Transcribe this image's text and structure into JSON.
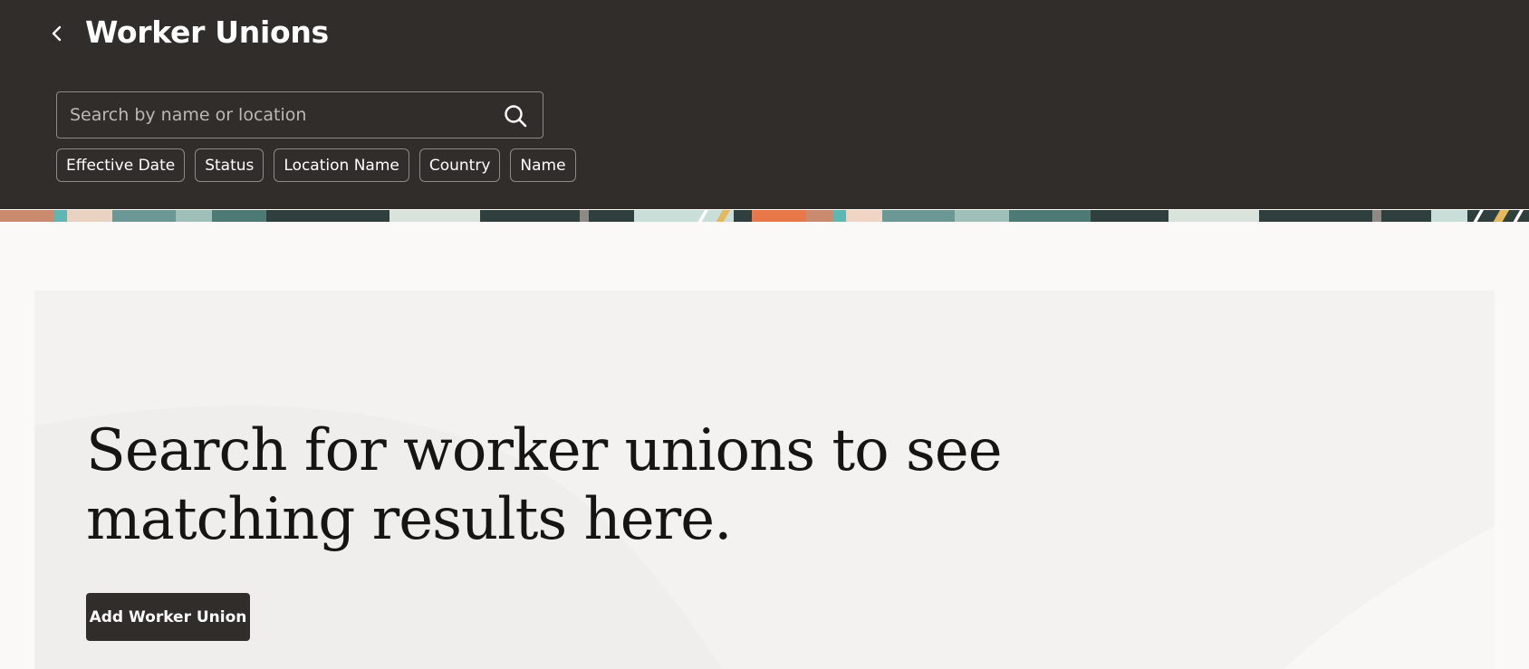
{
  "header": {
    "title": "Worker Unions",
    "back_icon": "chevron-left-icon"
  },
  "search": {
    "placeholder": "Search by name or location",
    "value": "",
    "icon": "search-icon"
  },
  "filters": [
    {
      "label": "Effective Date"
    },
    {
      "label": "Status"
    },
    {
      "label": "Location Name"
    },
    {
      "label": "Country"
    },
    {
      "label": "Name"
    }
  ],
  "empty_state": {
    "message": "Search for worker unions to see matching results here.",
    "button_label": "Add Worker Union"
  },
  "colors": {
    "header_bg": "#312d2a",
    "page_bg": "#faf9f8",
    "panel_bg": "#f3f2f0",
    "button_bg": "#312d2a",
    "band_teal": "#5f8f8b",
    "band_orange": "#e8784a",
    "band_yellow": "#e5b85c"
  }
}
